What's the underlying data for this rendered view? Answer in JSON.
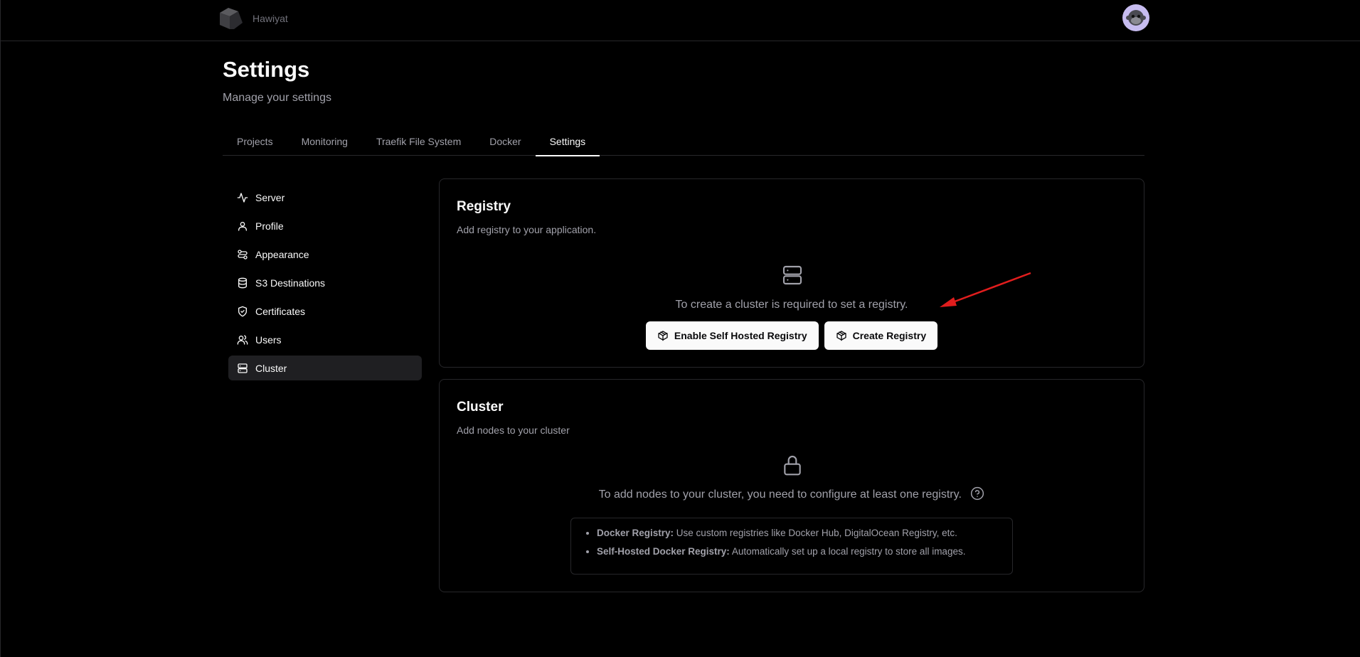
{
  "app": {
    "name": "Hawiyat"
  },
  "header": {
    "title": "Settings",
    "subtitle": "Manage your settings"
  },
  "tabs": [
    {
      "label": "Projects"
    },
    {
      "label": "Monitoring"
    },
    {
      "label": "Traefik File System"
    },
    {
      "label": "Docker"
    },
    {
      "label": "Settings",
      "active": true
    }
  ],
  "sidebar": {
    "items": [
      {
        "label": "Server",
        "icon": "activity-icon"
      },
      {
        "label": "Profile",
        "icon": "user-icon"
      },
      {
        "label": "Appearance",
        "icon": "palette-icon"
      },
      {
        "label": "S3 Destinations",
        "icon": "database-icon"
      },
      {
        "label": "Certificates",
        "icon": "shield-check-icon"
      },
      {
        "label": "Users",
        "icon": "users-icon"
      },
      {
        "label": "Cluster",
        "icon": "server-icon",
        "active": true
      }
    ]
  },
  "registry": {
    "title": "Registry",
    "description": "Add registry to your application.",
    "message": "To create a cluster is required to set a registry.",
    "enable_button": "Enable Self Hosted Registry",
    "create_button": "Create Registry"
  },
  "cluster": {
    "title": "Cluster",
    "description": "Add nodes to your cluster",
    "message": "To add nodes to your cluster, you need to configure at least one registry.",
    "bullets": [
      {
        "term": "Docker Registry:",
        "text": " Use custom registries like Docker Hub, DigitalOcean Registry, etc."
      },
      {
        "term": "Self-Hosted Docker Registry:",
        "text": " Automatically set up a local registry to store all images."
      }
    ]
  },
  "colors": {
    "background": "#000000",
    "border": "#27272a",
    "muted": "#a1a1aa",
    "annotation_arrow": "#e11d1d"
  }
}
